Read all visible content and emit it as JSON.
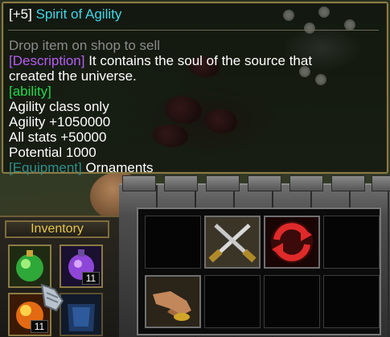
{
  "tooltip": {
    "level": "[+5]",
    "item_name": "Spirit of Agility",
    "sell_hint": "Drop item on shop to sell",
    "description_tag": "[Description]",
    "description_line1": " It contains the soul of the source that",
    "description_line2": "created the universe.",
    "ability_tag": "[ability]",
    "abilities": [
      "Agility class only",
      "Agility +1050000",
      "All stats +50000",
      "Potential 1000"
    ],
    "equipment_tag": "[Equipment]",
    "equipment_type": " Ornaments"
  },
  "inventory": {
    "label": "Inventory",
    "hero_slots": [
      {
        "icon": "green-potion-icon",
        "count": ""
      },
      {
        "icon": "purple-flask-icon",
        "count": "11"
      },
      {
        "icon": "orange-gem-icon",
        "count": "11"
      },
      {
        "icon": "blue-armor-icon",
        "count": ""
      }
    ]
  },
  "command_grid": {
    "slots": [
      {
        "icon": "",
        "label": ""
      },
      {
        "icon": "crossed-swords-icon",
        "label": "attack"
      },
      {
        "icon": "red-cycle-icon",
        "label": "cycle"
      },
      {
        "icon": "",
        "label": ""
      },
      {
        "icon": "hand-gold-icon",
        "label": "pickup"
      },
      {
        "icon": "",
        "label": ""
      },
      {
        "icon": "",
        "label": ""
      },
      {
        "icon": "",
        "label": ""
      }
    ]
  }
}
